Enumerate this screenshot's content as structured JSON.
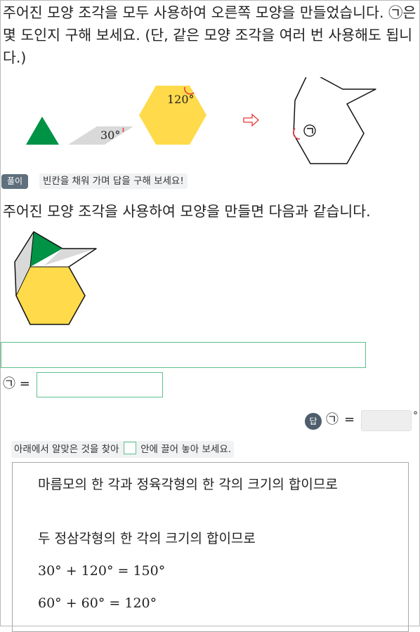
{
  "question": {
    "text": "주어진 모양 조각을 모두 사용하여 오른쪽 모양을 만들었습니다. ㉠은 몇 도인지 구해 보세요. (단, 같은 모양 조각을 여러 번 사용해도 됩니다.)"
  },
  "figure": {
    "angle_rhombus": "30°",
    "angle_hexagon": "120°",
    "target_symbol": "㉠",
    "colors": {
      "triangle": "#009245",
      "rhombus": "#d9d9d9",
      "hexagon": "#ffda4a",
      "arrow": "#e83a3a",
      "angle_mark": "#e83a3a"
    }
  },
  "solution": {
    "badge": "풀이",
    "hint": "빈칸을 채워 가며 답을 구해 보세요!",
    "sentence": "주어진 모양 조각을 사용하여 모양을 만들면 다음과 같습니다.",
    "equation_symbol": "㉠",
    "equals": "="
  },
  "answer": {
    "badge": "답",
    "symbol": "㉠",
    "equals": "=",
    "unit": "°"
  },
  "instruction": {
    "before": "아래에서 알맞은 것을 찾아",
    "after": "안에 끌어 놓아 보세요."
  },
  "choices": [
    "마름모의 한 각과 정육각형의 한 각의 크기의 합이므로",
    "두 정삼각형의 한 각의 크기의 합이므로",
    "30° + 120° = 150°",
    "60° + 60° = 120°"
  ],
  "colors": {
    "accent_green": "#5dc08a",
    "badge_gray": "#5f6f7d",
    "hint_bg": "#f0f2f3"
  }
}
